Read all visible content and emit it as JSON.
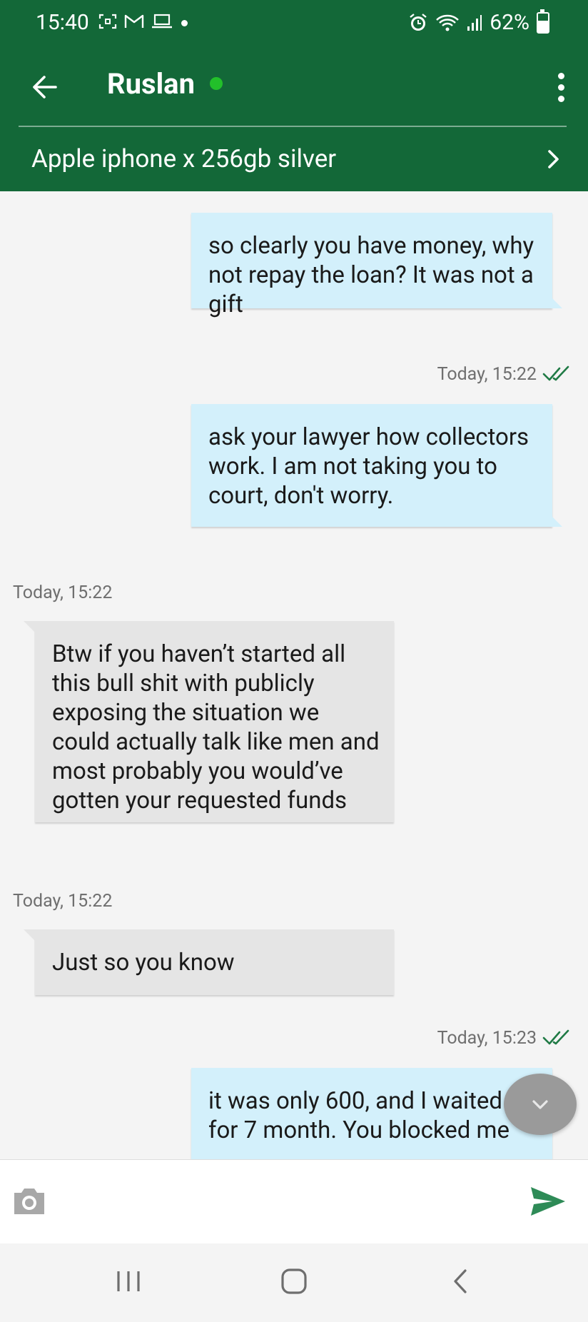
{
  "status_bar": {
    "time": "15:40",
    "battery": "62%"
  },
  "header": {
    "contact_name": "Ruslan",
    "product_title": "Apple iphone x 256gb silver"
  },
  "messages": [
    {
      "direction": "outgoing",
      "text": "so clearly you have money, why not repay the loan? It was not a gift"
    },
    {
      "type": "timestamp",
      "text": "Today, 15:22",
      "read": true
    },
    {
      "direction": "outgoing",
      "text": "ask your lawyer how collectors work. I am not taking you to court, don't worry."
    },
    {
      "type": "timestamp",
      "text": "Today, 15:22"
    },
    {
      "direction": "incoming",
      "text": "Btw if you haven’t started all this bull shit with publicly exposing the situation we could actually talk like men and most probably you would’ve gotten your requested funds"
    },
    {
      "type": "timestamp",
      "text": "Today, 15:22"
    },
    {
      "direction": "incoming",
      "text": "Just so you know"
    },
    {
      "type": "timestamp",
      "text": "Today, 15:23",
      "read": true
    },
    {
      "direction": "outgoing",
      "text": "it was only 600, and I waited for 7 month. You blocked me"
    }
  ],
  "colors": {
    "header_green": "#136838",
    "outgoing_bubble": "#d3f0fb",
    "incoming_bubble": "#e5e5e5",
    "online_dot": "#22c02a",
    "read_ticks": "#1f7a45",
    "send_icon": "#2e8b57"
  },
  "icons": [
    "back-arrow-icon",
    "more-vert-icon",
    "chevron-right-icon",
    "double-check-icon",
    "chevron-down-icon",
    "camera-icon",
    "send-icon",
    "nav-recents-icon",
    "nav-home-icon",
    "nav-back-icon"
  ]
}
